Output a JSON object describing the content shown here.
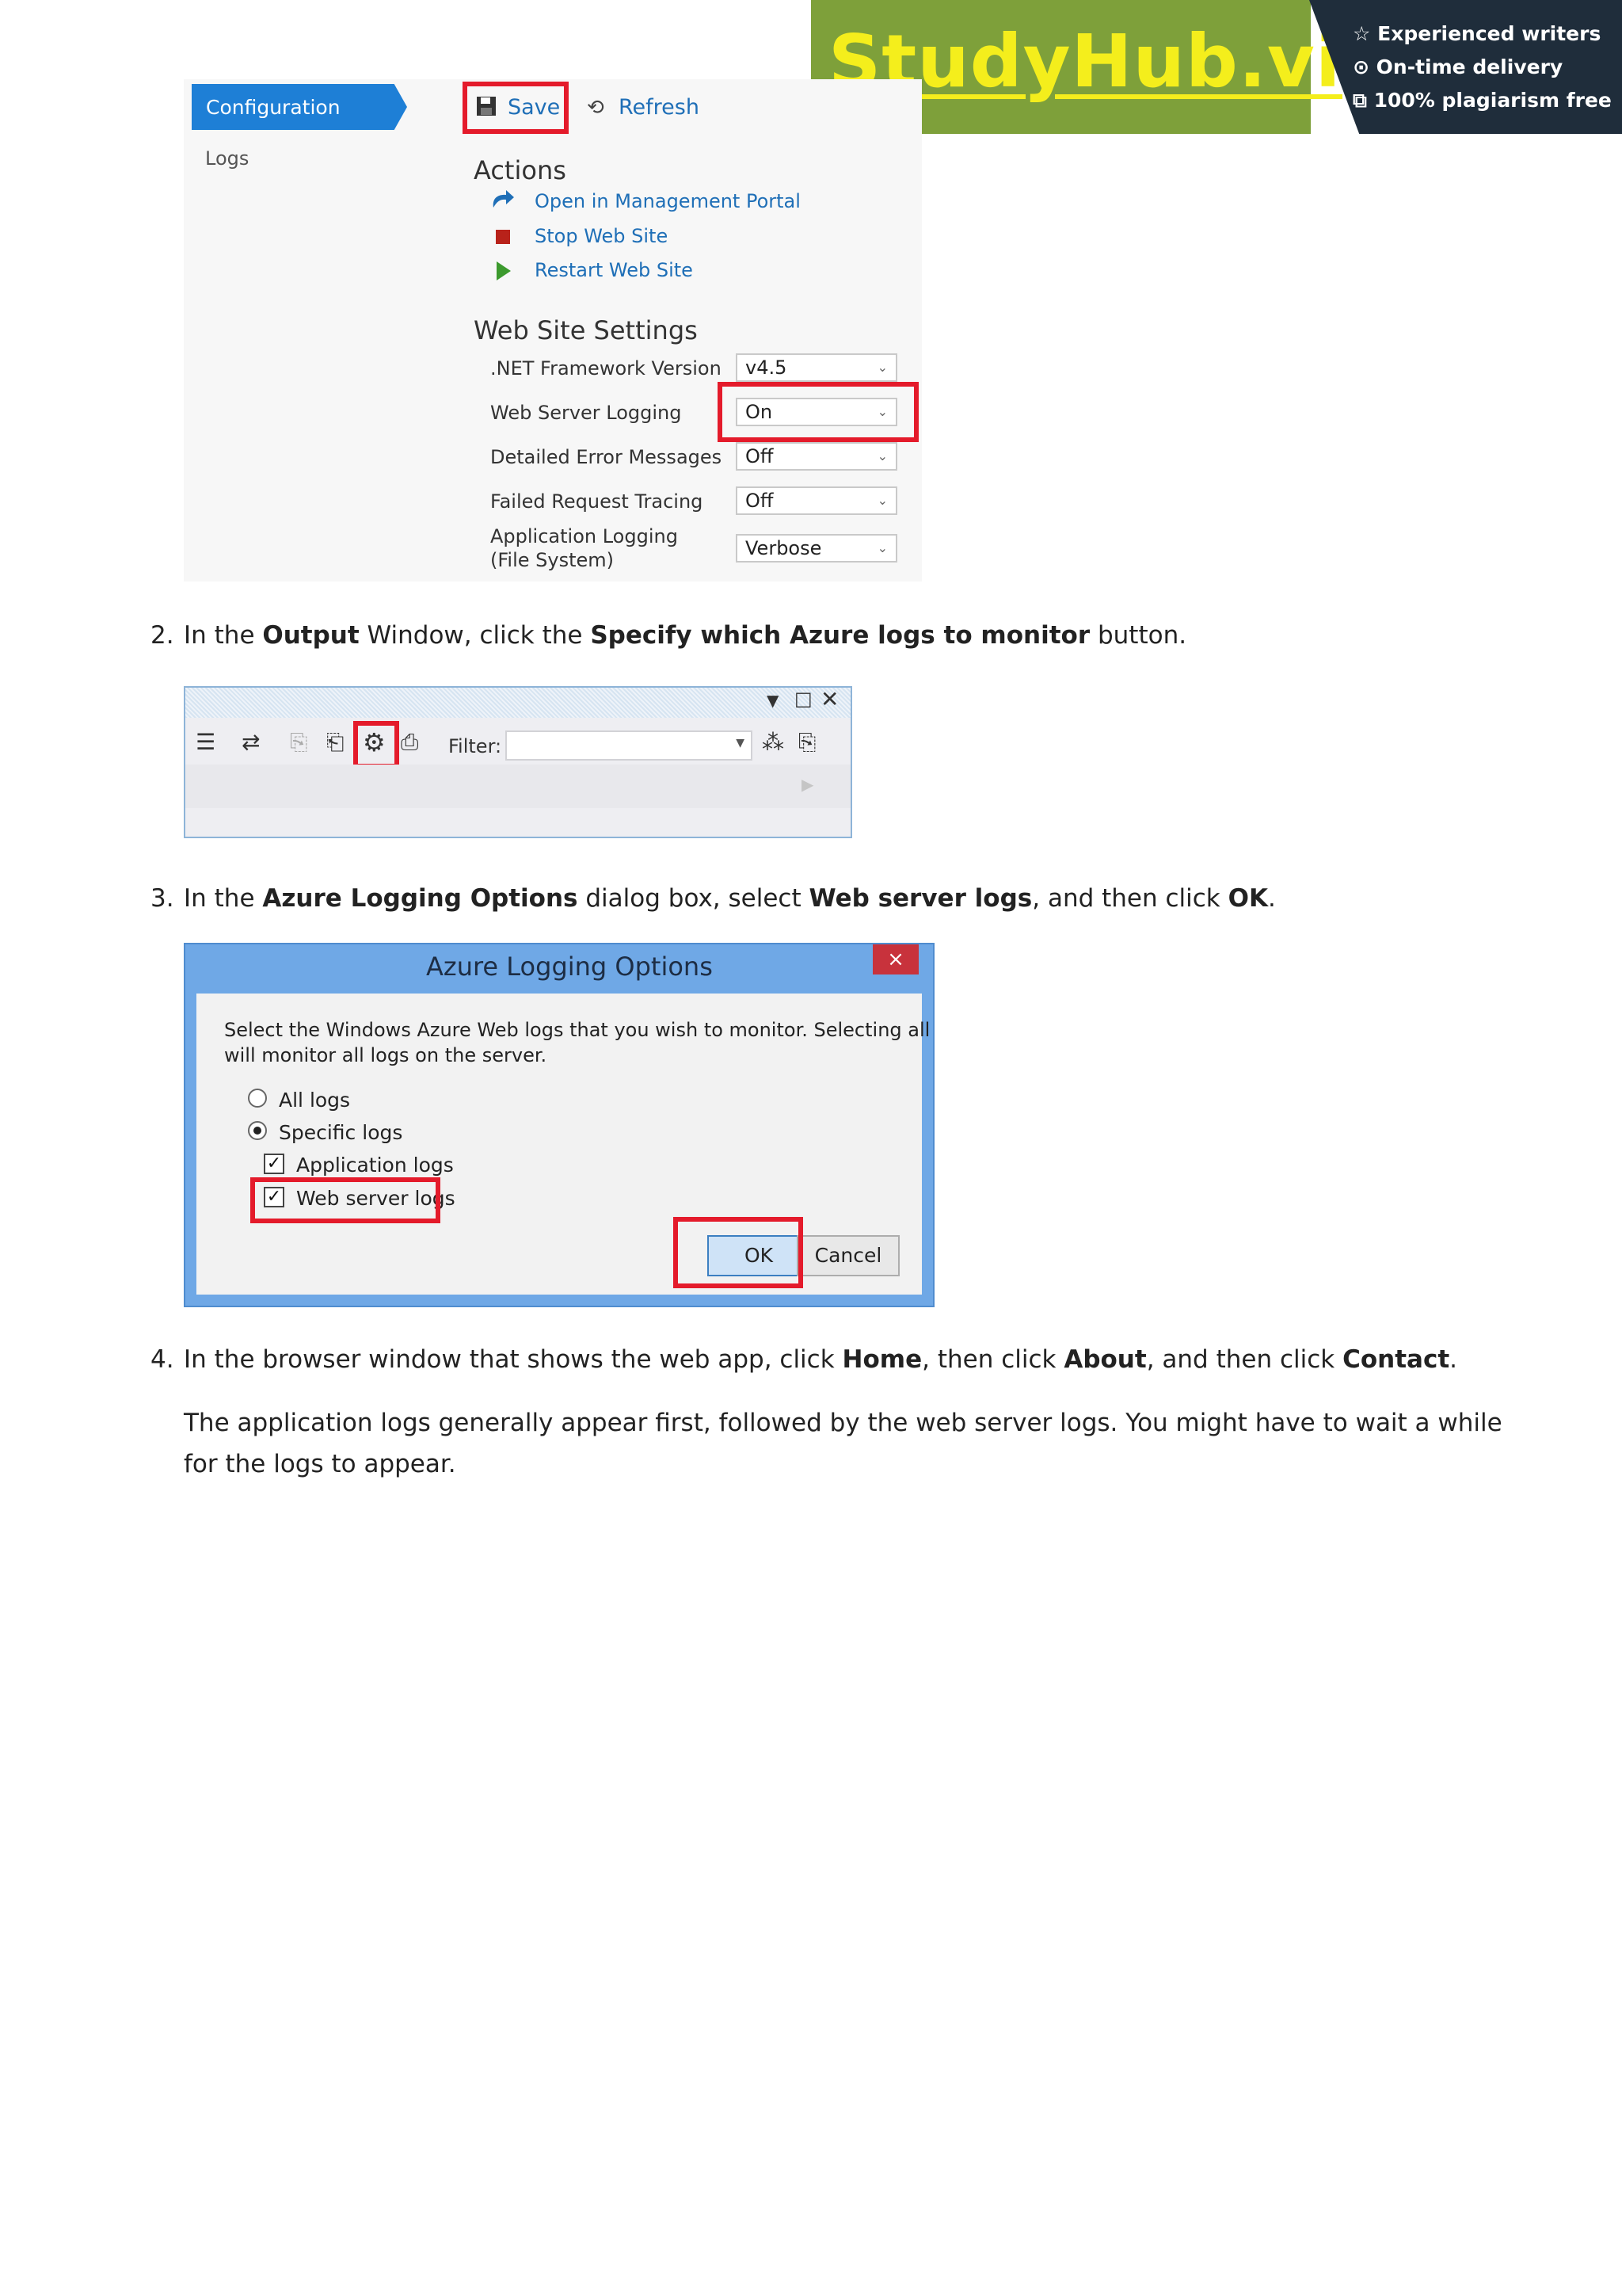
{
  "banner": {
    "logo": "StudyHub.vip",
    "features": [
      "Experienced writers",
      "On-time delivery",
      "100% plagiarism free"
    ],
    "colors": {
      "green": "#7ea03a",
      "logo_yellow": "#f4ee1c",
      "dark": "#1f2d3b"
    }
  },
  "config_screenshot": {
    "nav": {
      "configuration": "Configuration",
      "logs": "Logs"
    },
    "toolbar": {
      "save": "Save",
      "refresh": "Refresh"
    },
    "actions_title": "Actions",
    "actions": [
      {
        "label": "Open in Management Portal",
        "icon": "arrow-redo-icon"
      },
      {
        "label": "Stop Web Site",
        "icon": "stop-square-icon"
      },
      {
        "label": "Restart Web Site",
        "icon": "play-triangle-icon"
      }
    ],
    "settings_title": "Web Site Settings",
    "settings": [
      {
        "label": ".NET Framework Version",
        "value": "v4.5"
      },
      {
        "label": "Web Server Logging",
        "value": "On"
      },
      {
        "label": "Detailed Error Messages",
        "value": "Off"
      },
      {
        "label": "Failed Request Tracing",
        "value": "Off"
      },
      {
        "label_line1": "Application Logging",
        "label_line2": "(File System)",
        "value": "Verbose"
      }
    ]
  },
  "steps": {
    "step2": {
      "num": "2.",
      "t1": "In the ",
      "b1": "Output",
      "t2": " Window, click the ",
      "b2": "Specify which Azure logs to monitor",
      "t3": " button."
    },
    "step3": {
      "num": "3.",
      "t1": "In the ",
      "b1": "Azure Logging Options",
      "t2": " dialog box, select ",
      "b2": "Web server logs",
      "t3": ", and then click ",
      "b3": "OK",
      "t4": "."
    },
    "step4": {
      "num": "4.",
      "t1": "In the browser window that shows the web app, click ",
      "b1": "Home",
      "t2": ", then click ",
      "b2": "About",
      "t3": ", and then click ",
      "b3": "Contact",
      "t4": "."
    }
  },
  "output_window": {
    "filter_label": "Filter:"
  },
  "dialog": {
    "title": "Azure Logging Options",
    "close": "×",
    "description_line1": "Select the Windows Azure Web logs that you wish to monitor. Selecting all",
    "description_line2": "will monitor all logs on the server.",
    "options": {
      "all_logs": "All logs",
      "specific_logs": "Specific logs",
      "application_logs": "Application logs",
      "web_server_logs": "Web server logs"
    },
    "ok": "OK",
    "cancel": "Cancel"
  },
  "closing": {
    "line1": "The application logs generally appear first, followed by the web server logs. You might have to wait a while",
    "line2": "for the logs to appear."
  }
}
